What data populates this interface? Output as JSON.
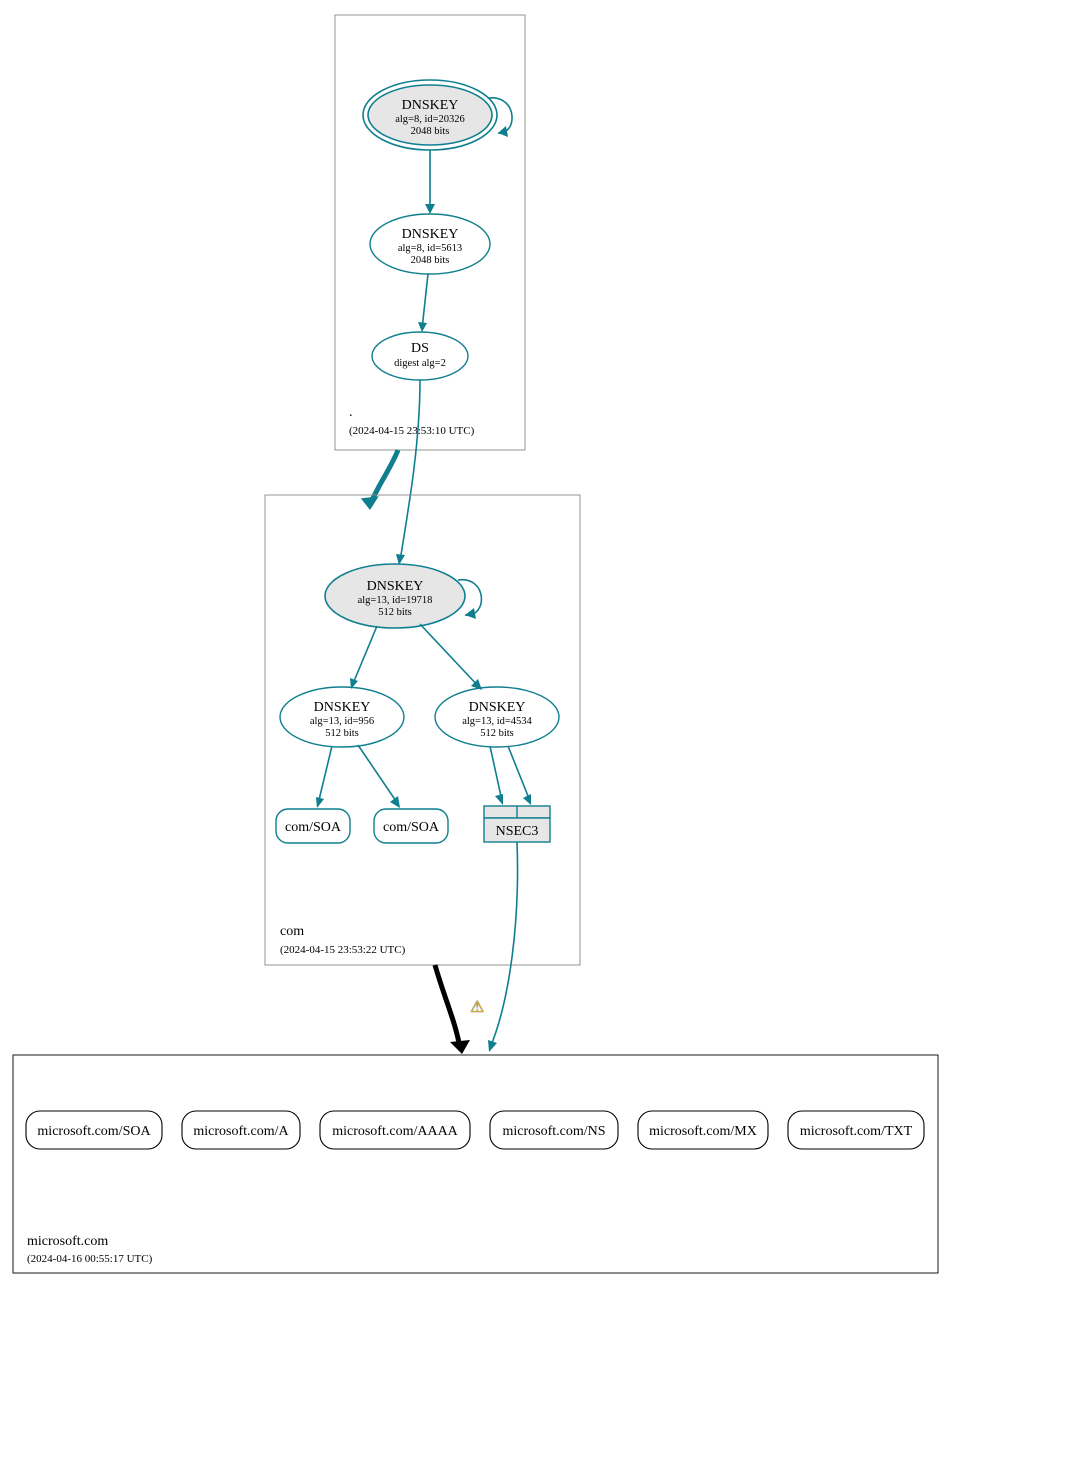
{
  "zones": {
    "root": {
      "label": ".",
      "timestamp": "(2024-04-15 23:53:10 UTC)"
    },
    "com": {
      "label": "com",
      "timestamp": "(2024-04-15 23:53:22 UTC)"
    },
    "microsoft": {
      "label": "microsoft.com",
      "timestamp": "(2024-04-16 00:55:17 UTC)"
    }
  },
  "nodes": {
    "root_ksk": {
      "title": "DNSKEY",
      "line2": "alg=8, id=20326",
      "line3": "2048 bits"
    },
    "root_zsk": {
      "title": "DNSKEY",
      "line2": "alg=8, id=5613",
      "line3": "2048 bits"
    },
    "root_ds": {
      "title": "DS",
      "line2": "digest alg=2"
    },
    "com_ksk": {
      "title": "DNSKEY",
      "line2": "alg=13, id=19718",
      "line3": "512 bits"
    },
    "com_zsk1": {
      "title": "DNSKEY",
      "line2": "alg=13, id=956",
      "line3": "512 bits"
    },
    "com_zsk2": {
      "title": "DNSKEY",
      "line2": "alg=13, id=4534",
      "line3": "512 bits"
    },
    "com_soa1": {
      "title": "com/SOA"
    },
    "com_soa2": {
      "title": "com/SOA"
    },
    "com_nsec3": {
      "title": "NSEC3"
    },
    "ms_soa": {
      "title": "microsoft.com/SOA"
    },
    "ms_a": {
      "title": "microsoft.com/A"
    },
    "ms_aaaa": {
      "title": "microsoft.com/AAAA"
    },
    "ms_ns": {
      "title": "microsoft.com/NS"
    },
    "ms_mx": {
      "title": "microsoft.com/MX"
    },
    "ms_txt": {
      "title": "microsoft.com/TXT"
    }
  },
  "warning_icon": "⚠"
}
